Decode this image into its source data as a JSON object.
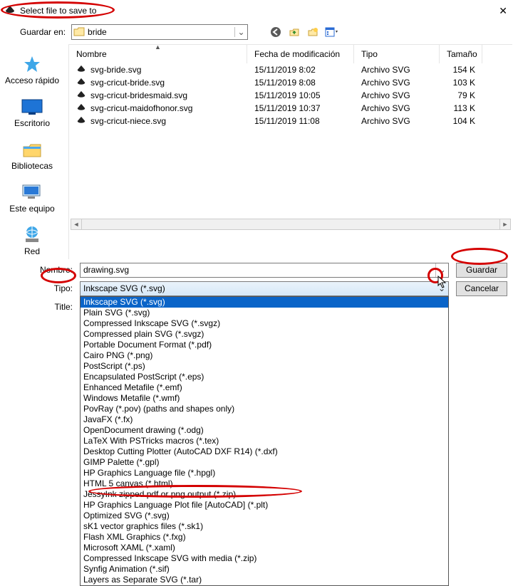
{
  "window": {
    "title": "Select file to save to"
  },
  "toolbar": {
    "save_in_label": "Guardar en:",
    "folder_name": "bride"
  },
  "places": [
    {
      "label": "Acceso rápido"
    },
    {
      "label": "Escritorio"
    },
    {
      "label": "Bibliotecas"
    },
    {
      "label": "Este equipo"
    },
    {
      "label": "Red"
    }
  ],
  "columns": {
    "name": "Nombre",
    "date": "Fecha de modificación",
    "type": "Tipo",
    "size": "Tamaño"
  },
  "files": [
    {
      "name": "svg-bride.svg",
      "date": "15/11/2019 8:02",
      "type": "Archivo SVG",
      "size": "154 K"
    },
    {
      "name": "svg-cricut-bride.svg",
      "date": "15/11/2019 8:08",
      "type": "Archivo SVG",
      "size": "103 K"
    },
    {
      "name": "svg-cricut-bridesmaid.svg",
      "date": "15/11/2019 10:05",
      "type": "Archivo SVG",
      "size": "79 K"
    },
    {
      "name": "svg-cricut-maidofhonor.svg",
      "date": "15/11/2019 10:37",
      "type": "Archivo SVG",
      "size": "113 K"
    },
    {
      "name": "svg-cricut-niece.svg",
      "date": "15/11/2019 11:08",
      "type": "Archivo SVG",
      "size": "104 K"
    }
  ],
  "form": {
    "name_label": "Nombre:",
    "name_value": "drawing.svg",
    "type_label": "Tipo:",
    "type_value": "Inkscape SVG (*.svg)",
    "title_label": "Title:",
    "save_button": "Guardar",
    "cancel_button": "Cancelar"
  },
  "type_options": [
    "Inkscape SVG (*.svg)",
    "Plain SVG (*.svg)",
    "Compressed Inkscape SVG (*.svgz)",
    "Compressed plain SVG (*.svgz)",
    "Portable Document Format (*.pdf)",
    "Cairo PNG (*.png)",
    "PostScript (*.ps)",
    "Encapsulated PostScript (*.eps)",
    "Enhanced Metafile (*.emf)",
    "Windows Metafile (*.wmf)",
    "PovRay (*.pov) (paths and shapes only)",
    "JavaFX (*.fx)",
    "OpenDocument drawing (*.odg)",
    "LaTeX With PSTricks macros (*.tex)",
    "Desktop Cutting Plotter (AutoCAD DXF R14) (*.dxf)",
    "GIMP Palette (*.gpl)",
    "HP Graphics Language file (*.hpgl)",
    "HTML 5 canvas (*.html)",
    "JessyInk zipped pdf or png output (*.zip)",
    "HP Graphics Language Plot file [AutoCAD] (*.plt)",
    "Optimized SVG (*.svg)",
    "sK1 vector graphics files (*.sk1)",
    "Flash XML Graphics (*.fxg)",
    "Microsoft XAML (*.xaml)",
    "Compressed Inkscape SVG with media (*.zip)",
    "Synfig Animation (*.sif)",
    "Layers as Separate SVG (*.tar)"
  ]
}
